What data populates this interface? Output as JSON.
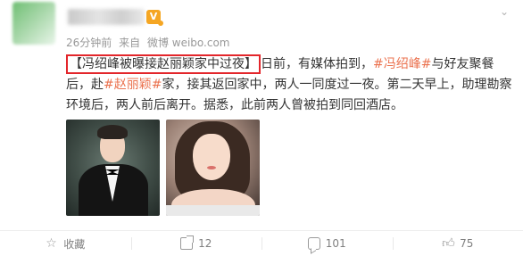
{
  "header": {
    "vip_badge": "V",
    "menu_icon": "chevron-down-icon"
  },
  "meta": {
    "time": "26分钟前",
    "source_prefix": "来自",
    "source": "微博 weibo.com"
  },
  "post": {
    "headline": "【冯绍峰被曝接赵丽颖家中过夜】",
    "text_1": "日前，有媒体拍到，",
    "topic_1": "#冯绍峰#",
    "text_2": "与好友聚餐后，赴",
    "topic_2": "#赵丽颖#",
    "text_3": "家，接其返回家中，两人一同度过一夜。第二天早上，助理勘察环境后，两人前后离开。据悉，此前两人曾被拍到同回酒店。"
  },
  "actions": {
    "favorite_label": "收藏",
    "share_count": "12",
    "comment_count": "101",
    "like_count": "75"
  },
  "colors": {
    "topic": "#eb7350",
    "highlight_border": "#e3262b",
    "meta": "#999999"
  }
}
